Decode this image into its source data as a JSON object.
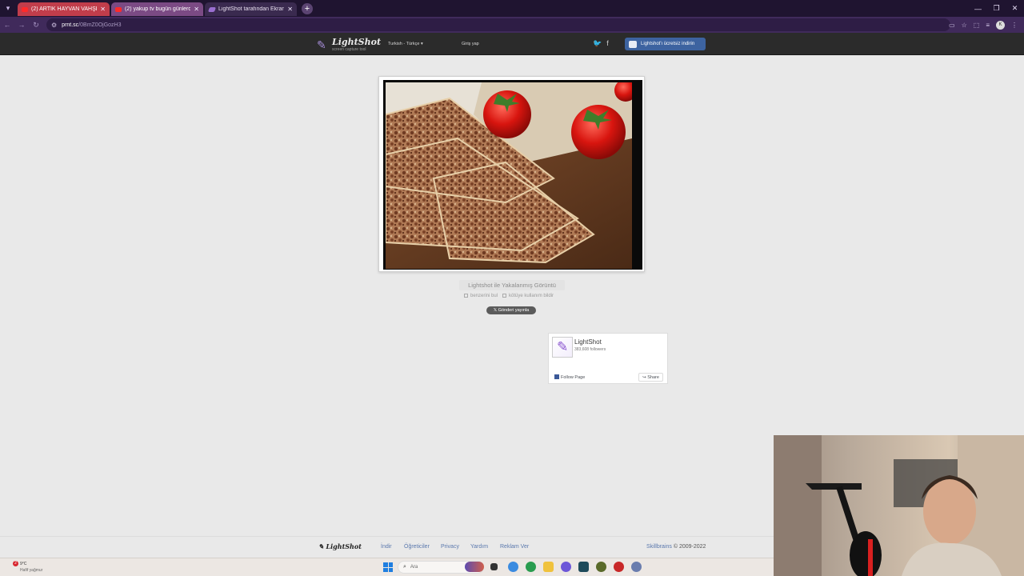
{
  "browser": {
    "tabs": [
      {
        "title": "(2) ARTIK HAYVAN VAHŞETİNE",
        "favicon": "youtube-icon"
      },
      {
        "title": "(2) yakup tv bugün günlerden ...",
        "favicon": "youtube-icon"
      },
      {
        "title": "LightShot tarafından Ekran Gö...",
        "favicon": "lightshot-feather-icon"
      }
    ],
    "url_host": "prnt.sc",
    "url_path": "/0BmZ0OjGozH3",
    "profile_initial": "K"
  },
  "site": {
    "logo_text": "LightShot",
    "logo_tagline": "screen capture tool",
    "language": "Turkish - Türkçe",
    "login_label": "Giriş yap",
    "download_label": "Lightshot'ı ücretsiz indirin",
    "caption": "Lightshot ile Yakalanmış Görüntü",
    "similar_label": "benzerini bul",
    "report_label": "kötüye kullanım bildir",
    "tweet_label": "Gönderi yayınla"
  },
  "facebook": {
    "page_name": "LightShot",
    "followers": "383,608 followers",
    "follow_label": "Follow Page",
    "share_label": "Share"
  },
  "footer": {
    "logo": "LightShot",
    "links": [
      "İndir",
      "Öğreticiler",
      "Privacy",
      "Yardım",
      "Reklam Ver"
    ],
    "brand": "Skillbrains",
    "copyright": "© 2009-2022"
  },
  "taskbar": {
    "weather_badge": "2",
    "temperature": "9°C",
    "condition": "Hafif yağmur",
    "search_placeholder": "Ara"
  }
}
